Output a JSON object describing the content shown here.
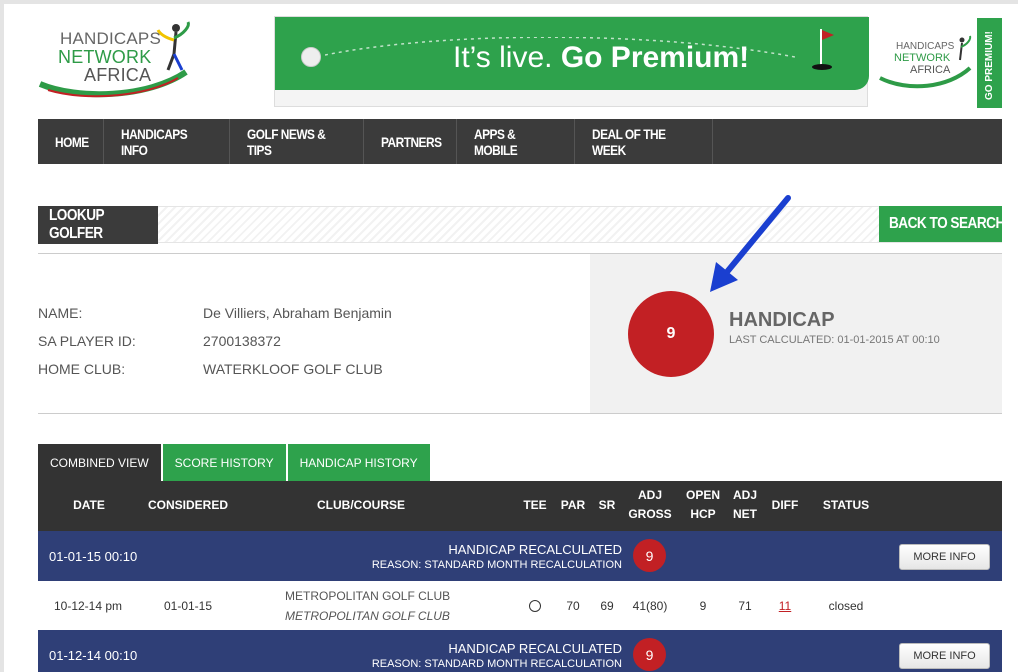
{
  "header": {
    "logo": {
      "line1": "HANDICAPS",
      "line2": "NETWORK",
      "line3": "AFRICA"
    },
    "banner": {
      "text_plain": "It’s live. ",
      "text_bold": "Go Premium!"
    },
    "side_ad": {
      "line1": "HANDICAPS",
      "line2": "NETWORK",
      "line3": "AFRICA",
      "cta": "GO PREMIUM!"
    }
  },
  "nav": [
    "HOME",
    "HANDICAPS INFO",
    "GOLF NEWS & TIPS",
    "PARTNERS",
    "APPS & MOBILE",
    "DEAL OF THE WEEK"
  ],
  "lookup": {
    "title": "LOOKUP GOLFER",
    "back": "BACK TO SEARCH"
  },
  "golfer": {
    "name_label": "NAME:",
    "name": "De Villiers, Abraham Benjamin",
    "id_label": "SA PLAYER ID:",
    "id": "2700138372",
    "club_label": "HOME CLUB:",
    "club": "WATERKLOOF GOLF CLUB"
  },
  "handicap": {
    "value": "9",
    "label": "HANDICAP",
    "last_calc": "LAST CALCULATED: 01-01-2015 AT 00:10"
  },
  "tabs": [
    "COMBINED VIEW",
    "SCORE HISTORY",
    "HANDICAP HISTORY"
  ],
  "table": {
    "headers": {
      "date": "DATE",
      "considered": "CONSIDERED",
      "club": "CLUB/COURSE",
      "tee": "TEE",
      "par": "PAR",
      "sr": "SR",
      "adj_gross_1": "ADJ",
      "adj_gross_2": "GROSS",
      "open_hcp_1": "OPEN",
      "open_hcp_2": "HCP",
      "adj_net_1": "ADJ",
      "adj_net_2": "NET",
      "diff": "DIFF",
      "status": "STATUS"
    },
    "recalc_rows": [
      {
        "date": "01-01-15 00:10",
        "title": "HANDICAP RECALCULATED",
        "reason": "REASON: STANDARD MONTH RECALCULATION",
        "value": "9",
        "button": "MORE INFO"
      },
      {
        "date": "01-12-14 00:10",
        "title": "HANDICAP RECALCULATED",
        "reason": "REASON: STANDARD MONTH RECALCULATION",
        "value": "9",
        "button": "MORE INFO"
      }
    ],
    "score_row": {
      "date": "10-12-14 pm",
      "considered": "01-01-15",
      "club": "METROPOLITAN GOLF CLUB",
      "course": "METROPOLITAN GOLF CLUB",
      "par": "70",
      "sr": "69",
      "adj_gross": "41(80)",
      "open_hcp": "9",
      "adj_net": "71",
      "diff": "11",
      "status": "closed"
    }
  },
  "colors": {
    "green": "#2ea24c",
    "dark": "#3b3b3b",
    "navy": "#2f3f77",
    "red": "#c22024",
    "arrow": "#1a3fd0"
  }
}
